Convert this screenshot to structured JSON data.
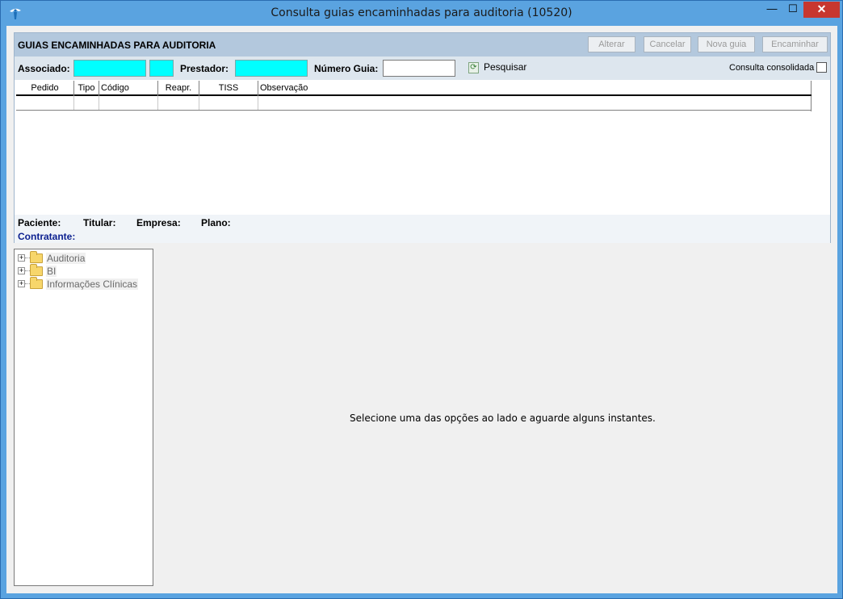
{
  "window": {
    "title": "Consulta guias encaminhadas para auditoria (10520)",
    "controls": {
      "minimize": "—",
      "maximize": "☐",
      "close": "✕"
    }
  },
  "panel": {
    "title": "GUIAS ENCAMINHADAS PARA AUDITORIA",
    "buttons": [
      "Alterar",
      "Cancelar",
      "Nova guia",
      "Encaminhar"
    ]
  },
  "search": {
    "associado_label": "Associado:",
    "prestador_label": "Prestador:",
    "numero_guia_label": "Número Guia:",
    "search_button": "Pesquisar",
    "consulta_consolidada": "Consulta consolidada"
  },
  "grid": {
    "columns": [
      "Pedido",
      "Tipo",
      "Código",
      "Reapr.",
      "TISS",
      "Observação"
    ]
  },
  "info": {
    "paciente": "Paciente:",
    "titular": "Titular:",
    "empresa": "Empresa:",
    "plano": "Plano:",
    "contratante": "Contratante:"
  },
  "tree": {
    "items": [
      "Auditoria",
      "BI",
      "Informações Clínicas"
    ]
  },
  "main": {
    "hint": "Selecione uma das opções ao lado e aguarde alguns instantes."
  },
  "colors": {
    "titlebar": "#5aa3e0",
    "header": "#b3c8dd",
    "cyan_field": "#00ffff",
    "contratante": "#0a1f8f"
  }
}
